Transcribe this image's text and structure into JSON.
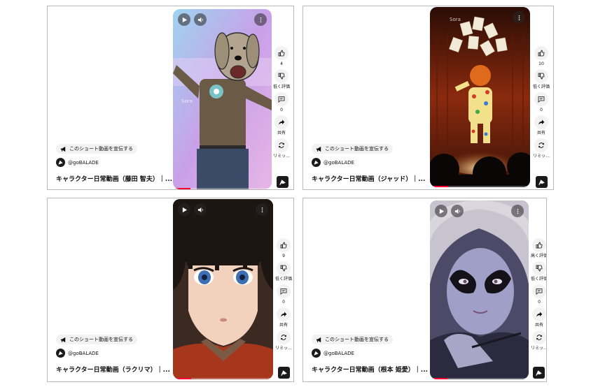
{
  "cards": [
    {
      "promo_label": "このショート動画を宣伝する",
      "channel": "@goBALADE",
      "title": "キャラクター日常動画（藤田 智夫）｜...",
      "watermark": "Sora",
      "actions": {
        "like_count": "4",
        "dislike_label": "低く評価",
        "comment_count": "0",
        "share_label": "共有",
        "remix_label": "リミッ..."
      }
    },
    {
      "promo_label": "このショート動画を宣伝する",
      "channel": "@goBALADE",
      "title": "キャラクター日常動画（ジャッド）｜...",
      "watermark": "Sora",
      "actions": {
        "like_count": "10",
        "dislike_label": "低く評価",
        "comment_count": "0",
        "share_label": "共有",
        "remix_label": "リミッ..."
      }
    },
    {
      "promo_label": "このショート動画を宣伝する",
      "channel": "@goBALADE",
      "title": "キャラクター日常動画（ラクリマ）｜...",
      "actions": {
        "like_count": "9",
        "dislike_label": "低く評価",
        "comment_count": "0",
        "share_label": "共有",
        "remix_label": "リミッ..."
      }
    },
    {
      "promo_label": "このショート動画を宣伝する",
      "channel": "@goBALADE",
      "title": "キャラクター日常動画（根本 姫愛）｜...",
      "actions": {
        "like_count": "高く評価",
        "dislike_label": "低く評価",
        "comment_count": "0",
        "share_label": "共有",
        "remix_label": "リミッ..."
      }
    }
  ],
  "icons": {
    "play": "play-icon",
    "volume": "volume-icon",
    "more": "more-vert-icon",
    "like": "thumb-up-icon",
    "dislike": "thumb-down-icon",
    "comment": "comment-icon",
    "share": "share-icon",
    "remix": "remix-icon",
    "promo": "megaphone-icon",
    "channel": "channel-avatar-icon",
    "sound": "sound-thumbnail-icon"
  },
  "colors": {
    "progress": "#ff0033",
    "button_bg": "#f2f2f2",
    "border": "#b9b9b9"
  }
}
